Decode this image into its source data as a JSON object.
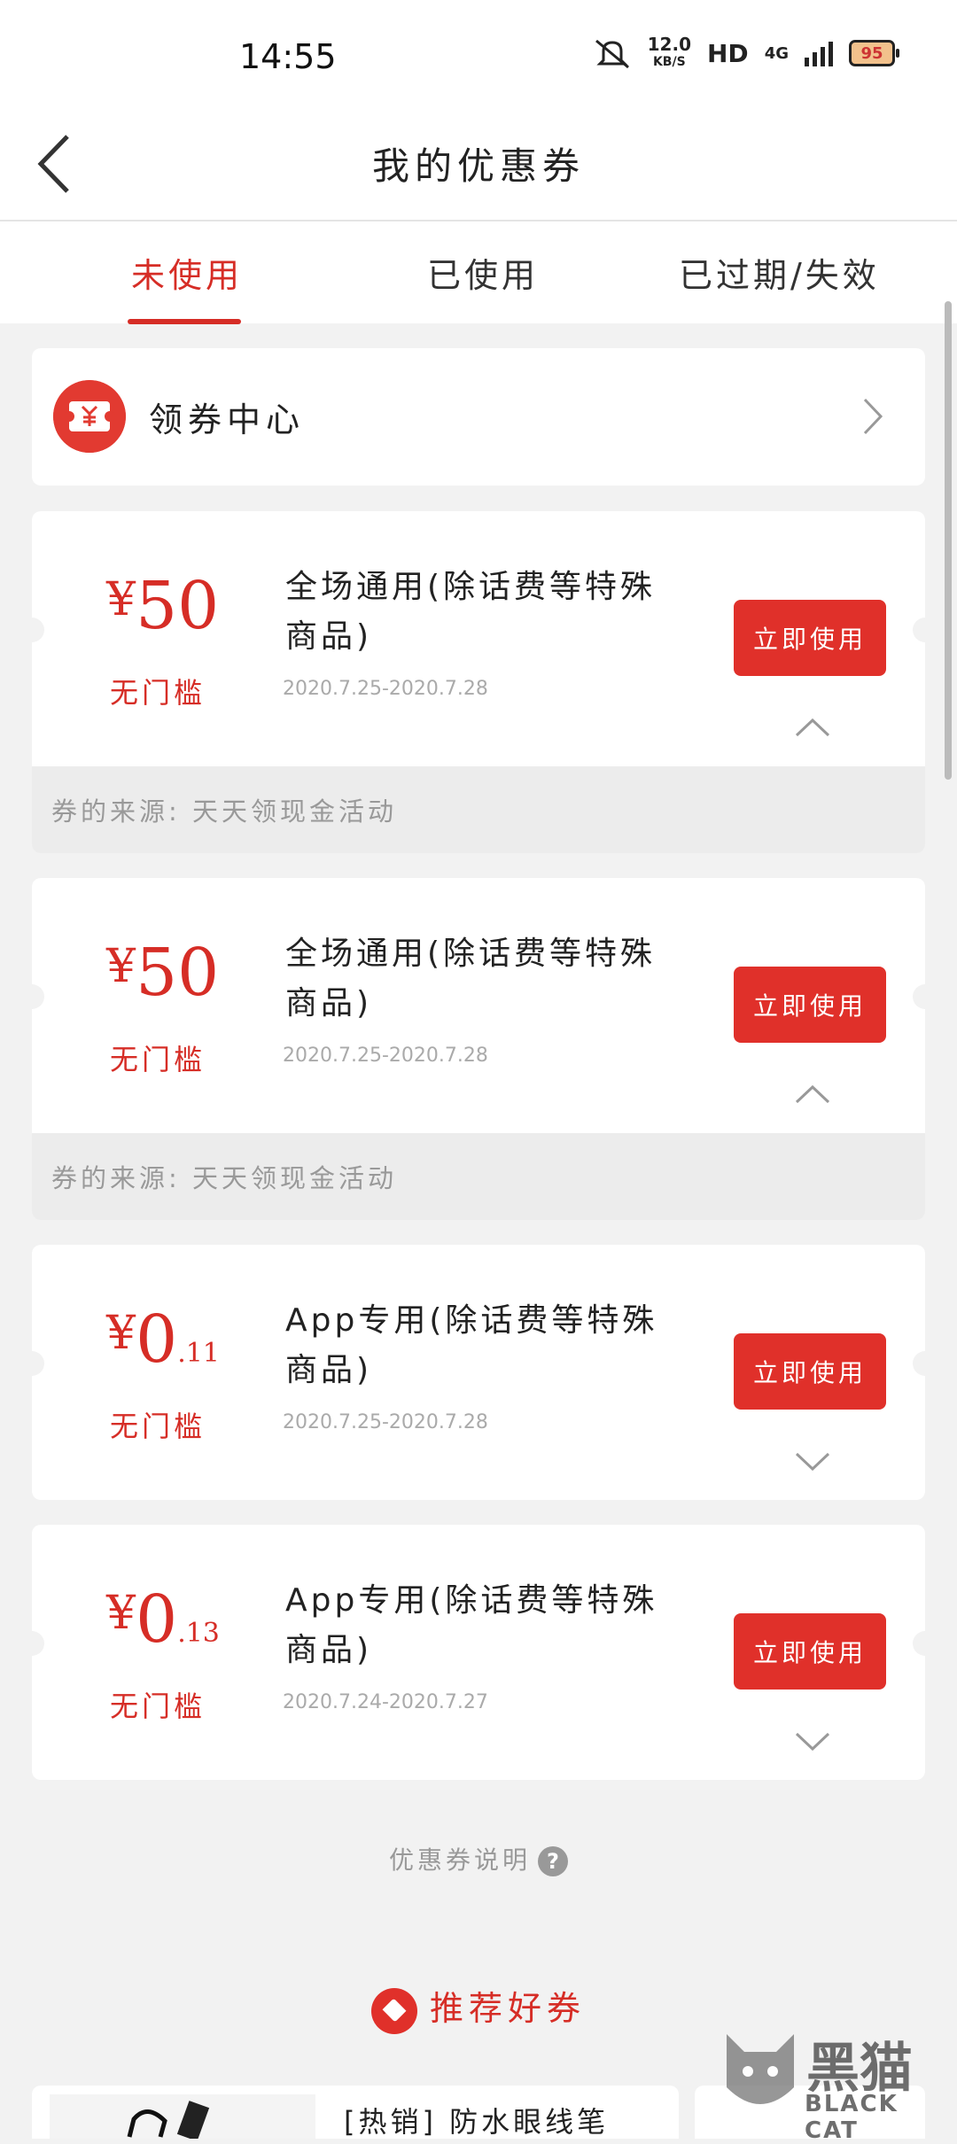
{
  "status_bar": {
    "time": "14:55",
    "speed_value": "12.0",
    "speed_unit": "KB/S",
    "hd": "HD",
    "network": "4G",
    "battery": "95"
  },
  "header": {
    "title": "我的优惠券"
  },
  "tabs": [
    {
      "label": "未使用",
      "active": true
    },
    {
      "label": "已使用",
      "active": false
    },
    {
      "label": "已过期/失效",
      "active": false
    }
  ],
  "coupon_center": {
    "label": "领券中心"
  },
  "coupons": [
    {
      "yen": "¥",
      "amount": "50",
      "decimal": "",
      "threshold": "无门槛",
      "title": "全场通用(除话费等特殊商品)",
      "date": "2020.7.25-2020.7.28",
      "button": "立即使用",
      "expanded": true,
      "source": "券的来源: 天天领现金活动"
    },
    {
      "yen": "¥",
      "amount": "50",
      "decimal": "",
      "threshold": "无门槛",
      "title": "全场通用(除话费等特殊商品)",
      "date": "2020.7.25-2020.7.28",
      "button": "立即使用",
      "expanded": true,
      "source": "券的来源: 天天领现金活动"
    },
    {
      "yen": "¥",
      "amount": "0",
      "decimal": ".11",
      "threshold": "无门槛",
      "title": "App专用(除话费等特殊商品)",
      "date": "2020.7.25-2020.7.28",
      "button": "立即使用",
      "expanded": false
    },
    {
      "yen": "¥",
      "amount": "0",
      "decimal": ".13",
      "threshold": "无门槛",
      "title": "App专用(除话费等特殊商品)",
      "date": "2020.7.24-2020.7.27",
      "button": "立即使用",
      "expanded": false
    }
  ],
  "note": {
    "label": "优惠券说明",
    "help_icon": "?"
  },
  "recommend": {
    "title": "推荐好券",
    "item_text": "[热销] 防水眼线笔"
  },
  "watermark": {
    "cn": "黑猫",
    "en": "BLACK CAT"
  },
  "colors": {
    "accent": "#d62d26",
    "button": "#e0302a",
    "background": "#f2f2f2"
  }
}
